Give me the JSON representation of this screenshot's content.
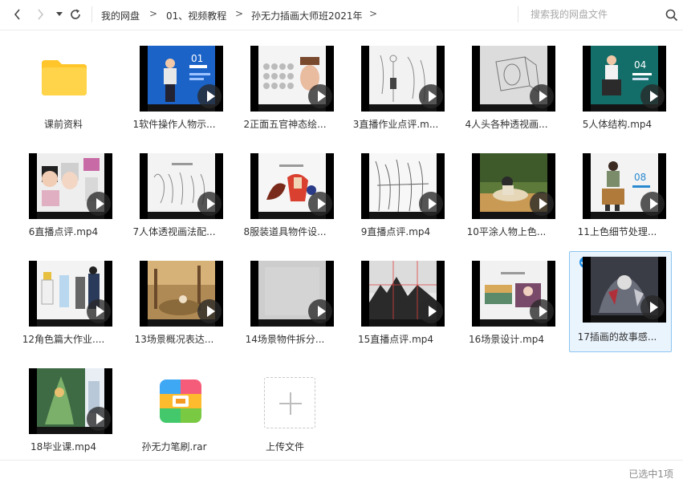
{
  "nav": {
    "back_glyph": "<",
    "forward_glyph": ">",
    "dropdown_glyph": "▾",
    "refresh_glyph": "↻",
    "breadcrumbs": [
      "我的网盘",
      "01、视频教程",
      "孙无力插画大师班2021年"
    ],
    "separator": ">"
  },
  "search": {
    "placeholder": "搜索我的网盘文件"
  },
  "colors": {
    "accent": "#1e8fe8",
    "selected_bg": "#eaf4fd",
    "selected_border": "#8cc5f0",
    "folder": "#ffd44a",
    "folder_tab": "#ffc52b"
  },
  "files": [
    {
      "name": "课前资料",
      "kind": "folder",
      "icon": "folder-icon"
    },
    {
      "name": "1软件操作人物示...",
      "kind": "video",
      "thumb_bg": "#1c63c8",
      "thumb_text": "01"
    },
    {
      "name": "2正面五官神态绘...",
      "kind": "video",
      "thumb_bg": "#f4f4f4"
    },
    {
      "name": "3直播作业点评.m...",
      "kind": "video",
      "thumb_bg": "#f2f2f2"
    },
    {
      "name": "4人头各种透视画...",
      "kind": "video",
      "thumb_bg": "#dcdcdc"
    },
    {
      "name": "5人体结构.mp4",
      "kind": "video",
      "thumb_bg": "#136e6a",
      "thumb_text": "04"
    },
    {
      "name": "6直播点评.mp4",
      "kind": "video",
      "thumb_bg": "#eeeeee"
    },
    {
      "name": "7人体透视画法配...",
      "kind": "video",
      "thumb_bg": "#f3f3f3"
    },
    {
      "name": "8服装道具物件设...",
      "kind": "video",
      "thumb_bg": "#f6f6f6"
    },
    {
      "name": "9直播点评.mp4",
      "kind": "video",
      "thumb_bg": "#f7f7f7"
    },
    {
      "name": "10平涂人物上色...",
      "kind": "video",
      "thumb_bg": "#5d7a3a"
    },
    {
      "name": "11上色细节处理...",
      "kind": "video",
      "thumb_bg": "#f3f3f3",
      "thumb_text": "08"
    },
    {
      "name": "12角色篇大作业....",
      "kind": "video",
      "thumb_bg": "#f3f3f3"
    },
    {
      "name": "13场景概况表达...",
      "kind": "video",
      "thumb_bg": "#b08a55"
    },
    {
      "name": "14场景物件拆分...",
      "kind": "video",
      "thumb_bg": "#cdcdcd"
    },
    {
      "name": "15直播点评.mp4",
      "kind": "video",
      "thumb_bg": "#e9e9e9"
    },
    {
      "name": "16场景设计.mp4",
      "kind": "video",
      "thumb_bg": "#f1f1f1"
    },
    {
      "name": "17插画的故事感...",
      "kind": "video",
      "thumb_bg": "#3b3d46",
      "selected": true
    },
    {
      "name": "18毕业课.mp4",
      "kind": "video",
      "thumb_bg": "#4e7a52"
    },
    {
      "name": "孙无力笔刷.rar",
      "kind": "archive",
      "icon": "rar-archive-icon"
    },
    {
      "name": "上传文件",
      "kind": "upload",
      "icon": "plus-icon"
    }
  ],
  "status": {
    "selection_text": "已选中1项"
  }
}
